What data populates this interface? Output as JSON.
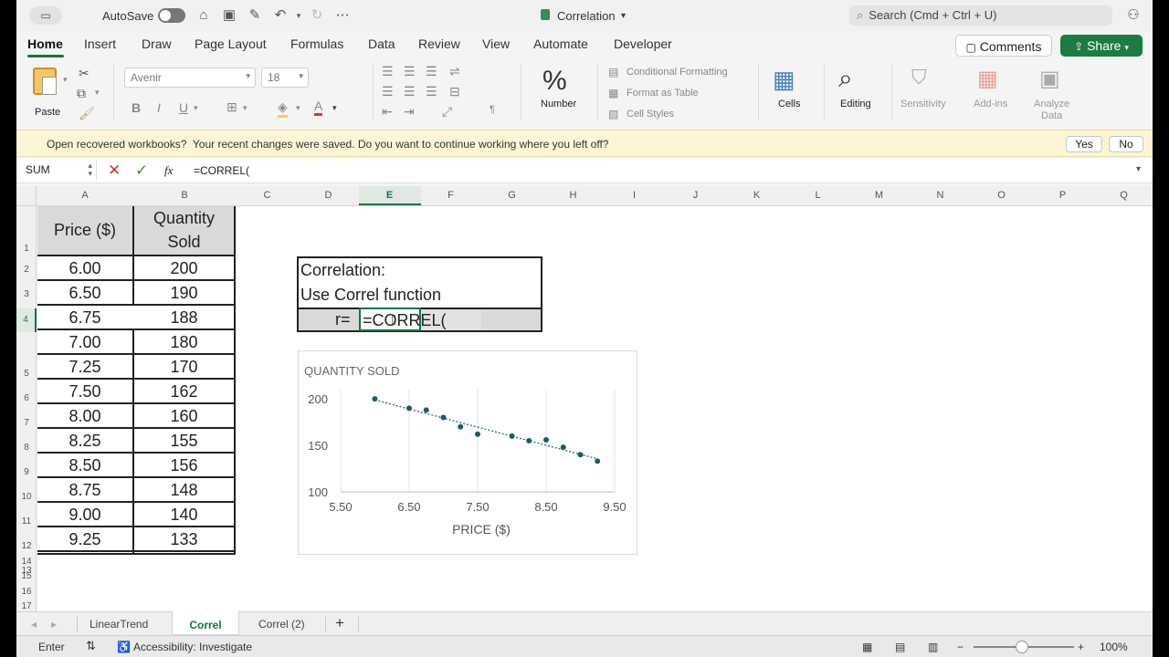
{
  "titlebar": {
    "autosave": "AutoSave",
    "doc_title": "Correlation",
    "search_placeholder": "Search (Cmd + Ctrl + U)"
  },
  "tabs": [
    "Home",
    "Insert",
    "Draw",
    "Page Layout",
    "Formulas",
    "Data",
    "Review",
    "View",
    "Automate",
    "Developer"
  ],
  "actions": {
    "comments": "Comments",
    "share": "Share"
  },
  "ribbon": {
    "paste": "Paste",
    "font": "Avenir",
    "font_size": "18",
    "number": "Number",
    "conditional_formatting": "Conditional Formatting",
    "format_as_table": "Format as Table",
    "cell_styles": "Cell Styles",
    "cells": "Cells",
    "editing": "Editing",
    "sensitivity": "Sensitivity",
    "add_ins": "Add-ins",
    "analyze_data": [
      "Analyze",
      "Data"
    ]
  },
  "message_bar": {
    "title": "Open recovered workbooks?",
    "text": "Your recent changes were saved. Do you want to continue working where you left off?",
    "yes": "Yes",
    "no": "No"
  },
  "formula_bar": {
    "name_box": "SUM",
    "fx": "fx",
    "formula": "=CORREL("
  },
  "columns": [
    "A",
    "B",
    "C",
    "D",
    "E",
    "F",
    "G",
    "H",
    "I",
    "J",
    "K",
    "L",
    "M",
    "N",
    "O",
    "P",
    "Q"
  ],
  "rows": [
    "1",
    "2",
    "3",
    "4",
    "5",
    "6",
    "7",
    "8",
    "9",
    "10",
    "11",
    "12",
    "13",
    "14",
    "15",
    "16",
    "17"
  ],
  "table": {
    "header_price": "Price ($)",
    "header_qty": [
      "Quantity",
      "Sold"
    ],
    "price": [
      "6.00",
      "6.50",
      "6.75",
      "7.00",
      "7.25",
      "7.50",
      "8.00",
      "8.25",
      "8.50",
      "8.75",
      "9.00",
      "9.25"
    ],
    "qty": [
      "200",
      "190",
      "188",
      "180",
      "170",
      "162",
      "160",
      "155",
      "156",
      "148",
      "140",
      "133"
    ]
  },
  "correl_box": {
    "line1": "Correlation:",
    "line2": "Use Correl function",
    "r_label": "r=",
    "edit_text": "=CORREL("
  },
  "chart_data": {
    "type": "scatter",
    "title": "QUANTITY SOLD",
    "xlabel": "PRICE ($)",
    "ylabel": "",
    "x_ticks": [
      "5.50",
      "6.50",
      "7.50",
      "8.50",
      "9.50"
    ],
    "y_ticks": [
      "100",
      "150",
      "200"
    ],
    "xlim": [
      5.5,
      9.5
    ],
    "ylim": [
      100,
      210
    ],
    "points": [
      [
        6,
        200
      ],
      [
        6.5,
        190
      ],
      [
        6.75,
        188
      ],
      [
        7,
        180
      ],
      [
        7.25,
        170
      ],
      [
        7.5,
        162
      ],
      [
        8,
        160
      ],
      [
        8.25,
        155
      ],
      [
        8.5,
        156
      ],
      [
        8.75,
        148
      ],
      [
        9,
        140
      ],
      [
        9.25,
        133
      ]
    ],
    "trendline": true,
    "grid": "vertical",
    "color": "#1f5b66"
  },
  "sheet_tabs": [
    "LinearTrend",
    "Correl",
    "Correl (2)"
  ],
  "add_sheet": "+",
  "status": {
    "mode": "Enter",
    "accessibility": "Accessibility: Investigate",
    "zoom": "100%",
    "minus": "−",
    "plus": "+"
  },
  "colors": {
    "accent": "#1d7044",
    "share_btn": "#1d7c45",
    "message_bg": "#fdf5d6",
    "active_cell_border": "#1d7044"
  }
}
